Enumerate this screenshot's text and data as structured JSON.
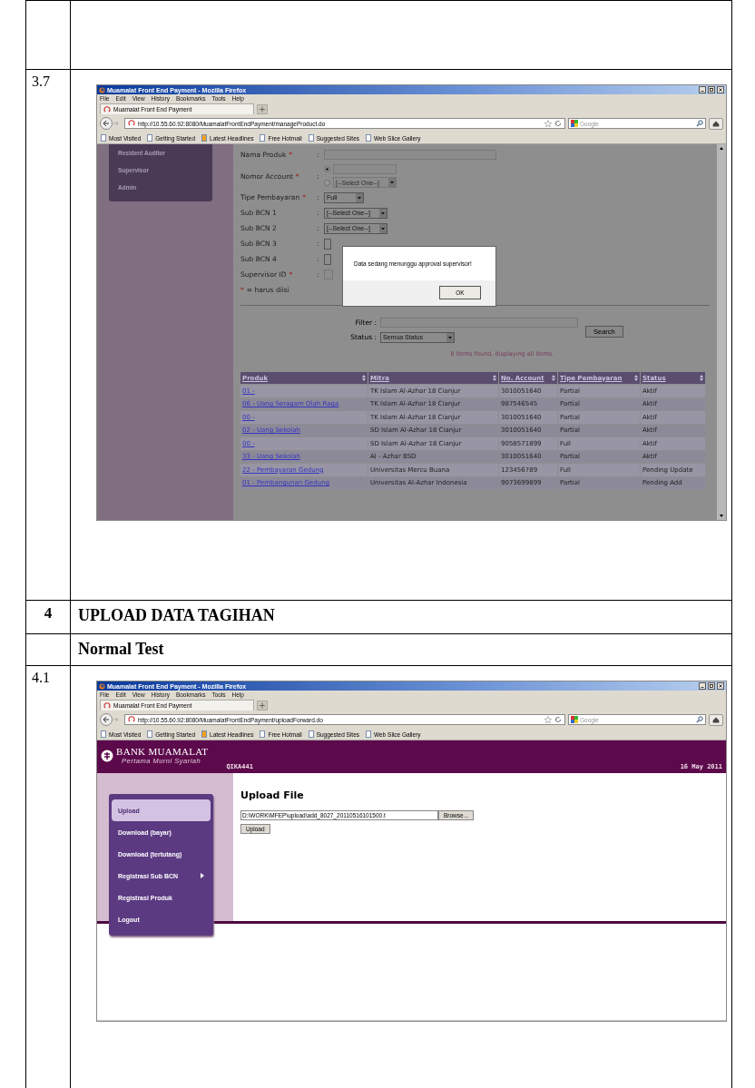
{
  "rows": [
    {
      "kind": "blank"
    },
    {
      "kind": "screenshot",
      "number": "3.7",
      "browser": {
        "title": "Muamalat Front End Payment - Mozilla Firefox",
        "menu": [
          "File",
          "Edit",
          "View",
          "History",
          "Bookmarks",
          "Tools",
          "Help"
        ],
        "tab": "Muamalat Front End Payment",
        "url": "http://10.55.60.92:8080/MuamalatFrontEndPayment/manageProduct.do",
        "search_placeholder": "Google",
        "bookmarks": [
          "Most Visited",
          "Getting Started",
          "Latest Headlines",
          "Free Hotmail",
          "Suggested Sites",
          "Web Slice Gallery"
        ],
        "page": {
          "kind": "product_form",
          "sidebar": [
            "Resident Auditor",
            "Supervisor",
            "Admin"
          ],
          "required_mark": "*",
          "separator": ":",
          "fields": [
            {
              "label": "Nama Produk",
              "required": true,
              "kind": "text"
            },
            {
              "label": "Nomor Account",
              "required": true,
              "kind": "account",
              "options": [
                {
                  "kind": "text",
                  "selected": true
                },
                {
                  "kind": "select",
                  "value": "[--Select One--]",
                  "selected": false
                }
              ]
            },
            {
              "label": "Tipe Pembayaran",
              "required": true,
              "kind": "select",
              "value": "Full"
            },
            {
              "label": "Sub BCN 1",
              "required": false,
              "kind": "select",
              "value": "[--Select One--]"
            },
            {
              "label": "Sub BCN 2",
              "required": false,
              "kind": "select",
              "value": "[--Select One--]"
            },
            {
              "label": "Sub BCN 3",
              "required": false,
              "kind": "select"
            },
            {
              "label": "Sub BCN 4",
              "required": false,
              "kind": "select"
            },
            {
              "label": "Supervisor ID",
              "required": true,
              "kind": "text"
            }
          ],
          "required_note": "= harus diisi",
          "filter_label": "Filter :",
          "status_label": "Status :",
          "status_value": "Semua Status",
          "search_button": "Search",
          "result_text": "8 items found, displaying all items.",
          "table": {
            "columns": [
              "Produk",
              "Mitra",
              "No. Account",
              "Tipe Pembayaran",
              "Status"
            ],
            "rows": [
              [
                "01 -",
                "TK Islam Al-Azhar 18 Cianjur",
                "3010051640",
                "Partial",
                "Aktif"
              ],
              [
                "06 - Uang Seragam Olah Raga",
                "TK Islam Al-Azhar 18 Cianjur",
                "987546545",
                "Partial",
                "Aktif"
              ],
              [
                "00 -",
                "TK Islam Al-Azhar 18 Cianjur",
                "3010051640",
                "Partial",
                "Aktif"
              ],
              [
                "02 - Uang Sekolah",
                "SD Islam Al-Azhar 18 Cianjur",
                "3010051640",
                "Partial",
                "Aktif"
              ],
              [
                "00 -",
                "SD Islam Al-Azhar 18 Cianjur",
                "9058571899",
                "Full",
                "Aktif"
              ],
              [
                "33 - Uang Sekolah",
                "Al - Azhar BSD",
                "3010051640",
                "Partial",
                "Aktif"
              ],
              [
                "22 - Pembayaran Gedung",
                "Universitas Mercu Buana",
                "123456789",
                "Full",
                "Pending Update"
              ],
              [
                "01 - Pembangunan Gedung",
                "Universitas Al-Azhar Indonesia",
                "9073699899",
                "Partial",
                "Pending Add"
              ]
            ]
          },
          "dialog": {
            "message": "Data sedang menunggu approval supervisor!",
            "button": "OK"
          }
        }
      }
    },
    {
      "kind": "heading",
      "number": "4",
      "title": "UPLOAD DATA TAGIHAN"
    },
    {
      "kind": "subheading",
      "title": "Normal Test"
    },
    {
      "kind": "screenshot",
      "number": "4.1",
      "browser": {
        "title": "Muamalat Front End Payment - Mozilla Firefox",
        "menu": [
          "File",
          "Edit",
          "View",
          "History",
          "Bookmarks",
          "Tools",
          "Help"
        ],
        "tab": "Muamalat Front End Payment",
        "url": "http://10.55.60.92:8080/MuamalatFrontEndPayment/uploadForward.do",
        "search_placeholder": "Google",
        "bookmarks": [
          "Most Visited",
          "Getting Started",
          "Latest Headlines",
          "Free Hotmail",
          "Suggested Sites",
          "Web Slice Gallery"
        ],
        "page": {
          "kind": "upload",
          "logo_name": "BANK MUAMALAT",
          "logo_tagline": "Pertama Murni Syariah",
          "user": "QIKA441",
          "date": "16 May 2011",
          "menu": [
            {
              "label": "Upload",
              "selected": true,
              "submenu": false
            },
            {
              "label": "Download (bayar)",
              "selected": false,
              "submenu": false
            },
            {
              "label": "Download (tertutang)",
              "selected": false,
              "submenu": false
            },
            {
              "label": "Registrasi Sub BCN",
              "selected": false,
              "submenu": true
            },
            {
              "label": "Registrasi Produk",
              "selected": false,
              "submenu": false
            },
            {
              "label": "Logout",
              "selected": false,
              "submenu": false
            }
          ],
          "heading": "Upload File",
          "file_value": "D:\\WORK\\MFEP\\upload\\add_8027_20110516101500.t",
          "browse_button": "Browse...",
          "upload_button": "Upload"
        }
      }
    }
  ]
}
